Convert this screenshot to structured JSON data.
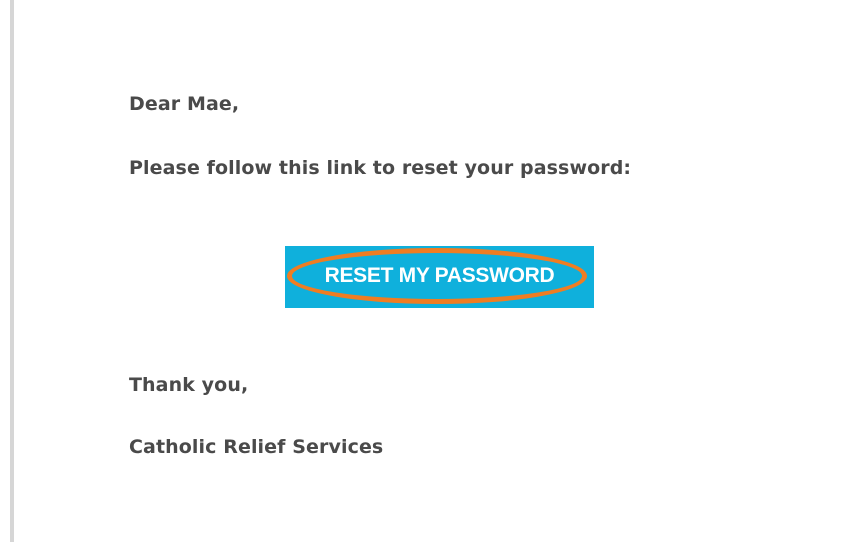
{
  "email": {
    "greeting": "Dear Mae,",
    "instruction": "Please follow this link to reset your password:",
    "button_label": "RESET MY PASSWORD",
    "closing": "Thank you,",
    "signature": "Catholic Relief Services"
  },
  "colors": {
    "button_background": "#0fb0dc",
    "button_text": "#ffffff",
    "highlight_ring": "#ef7d22",
    "body_text": "#4a4a4a",
    "left_border": "#d6d6d6"
  }
}
